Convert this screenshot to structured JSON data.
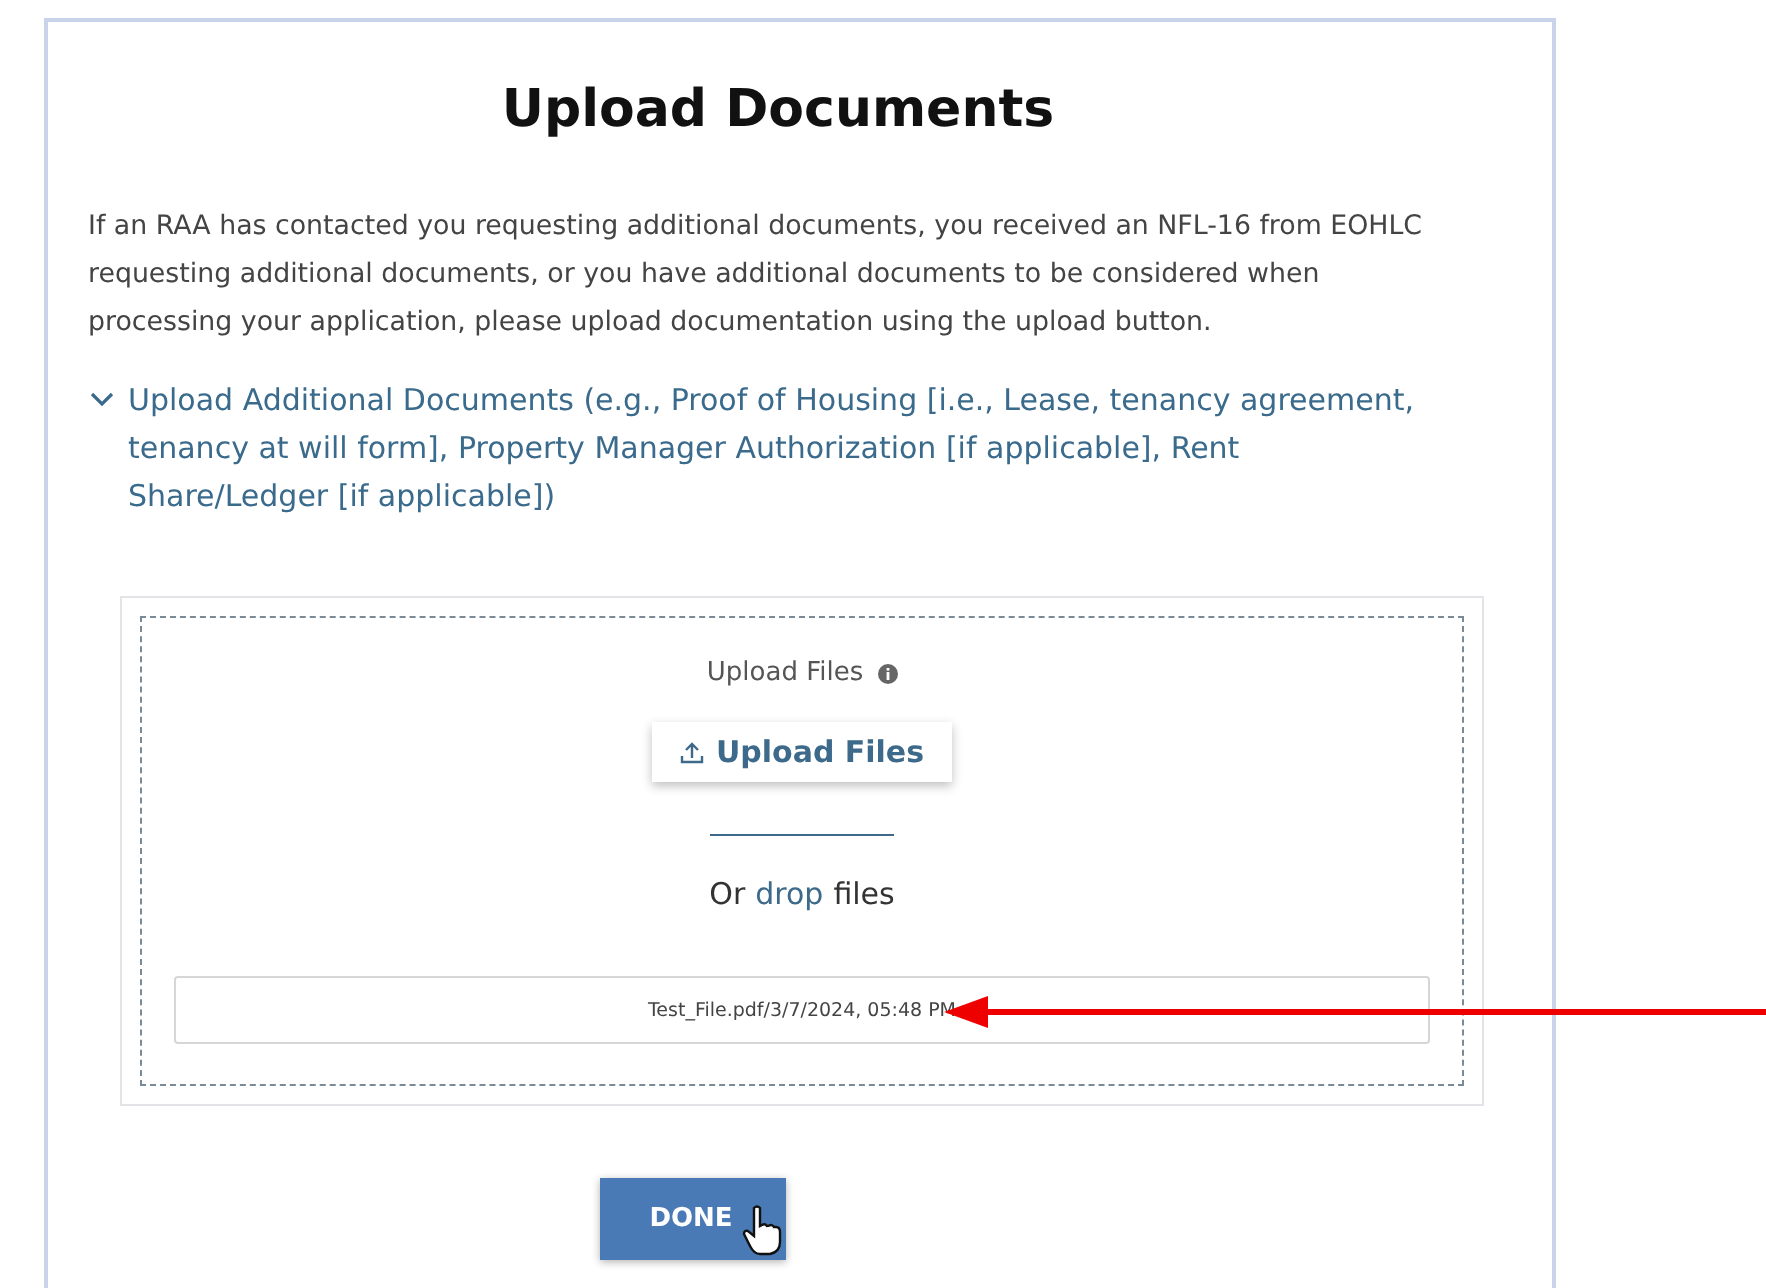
{
  "title": "Upload Documents",
  "intro": "If an RAA has contacted you requesting additional documents, you received an NFL-16 from EOHLC requesting additional documents, or you have additional documents to be considered when processing your application, please upload documentation using the upload button.",
  "accordion": {
    "label": "Upload Additional Documents (e.g., Proof of Housing [i.e., Lease, tenancy agreement, tenancy at will form], Property Manager Authorization [if applicable], Rent Share/Ledger [if applicable])",
    "expanded": true
  },
  "upload": {
    "label": "Upload Files",
    "button": "Upload Files",
    "drop_prefix": "Or",
    "drop_link": "drop",
    "drop_suffix": "files",
    "files": [
      {
        "name": "Test_File.pdf/3/7/2024, 05:48 PM"
      }
    ]
  },
  "done_button": "DONE"
}
